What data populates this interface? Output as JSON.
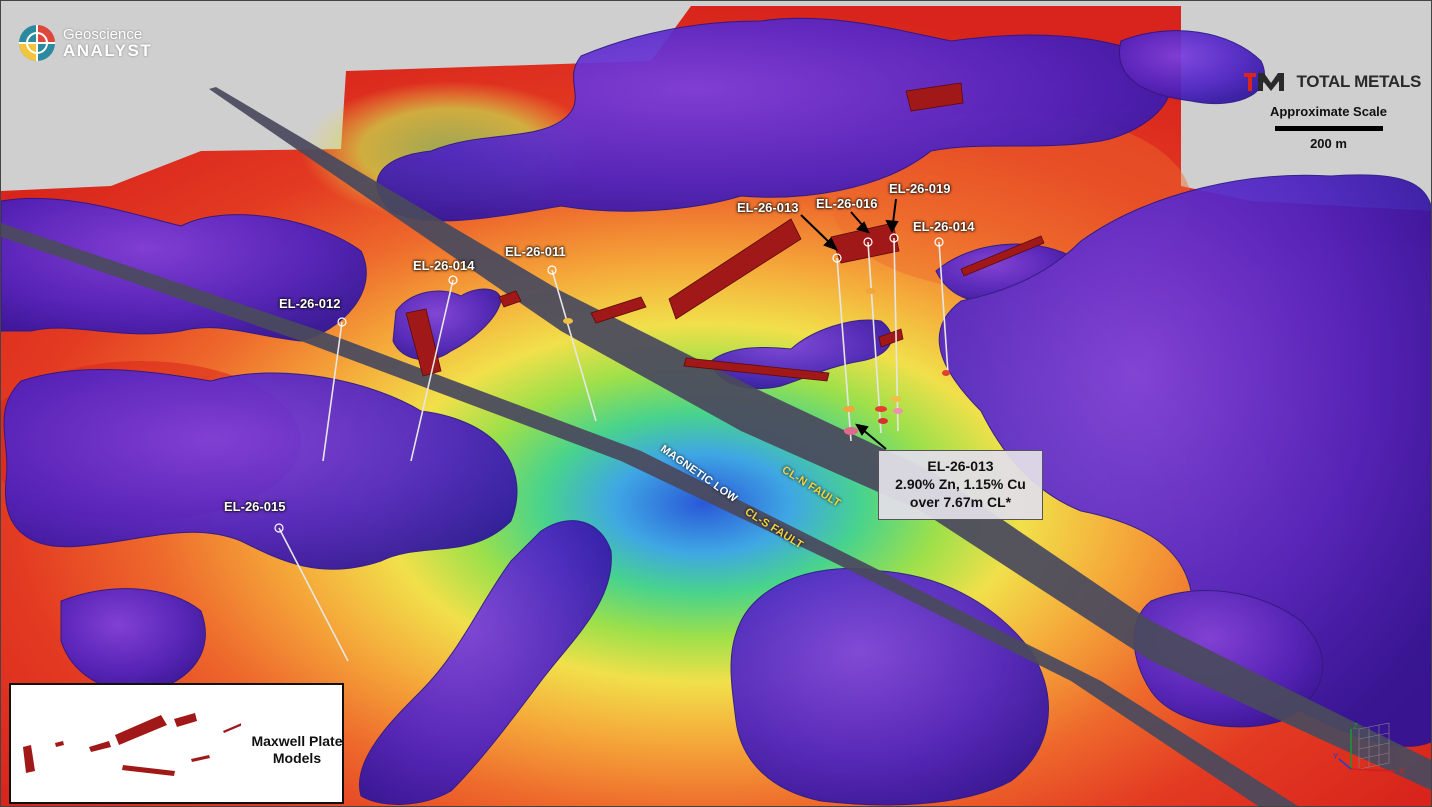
{
  "logo": {
    "line1": "Geoscience",
    "line2": "ANALYST"
  },
  "brand": {
    "name": "TOTAL METALS"
  },
  "scale": {
    "title": "Approximate Scale",
    "label": "200 m"
  },
  "drill_holes": [
    {
      "name": "EL-26-012"
    },
    {
      "name": "EL-26-014"
    },
    {
      "name": "EL-26-011"
    },
    {
      "name": "EL-26-013"
    },
    {
      "name": "EL-26-016"
    },
    {
      "name": "EL-26-019"
    },
    {
      "name": "EL-26-014"
    },
    {
      "name": "EL-26-015"
    }
  ],
  "annotations": {
    "magnetic_low": "MAGNETIC LOW",
    "cl_n_fault": "CL-N FAULT",
    "cl_s_fault": "CL-S FAULT"
  },
  "callout": {
    "line1": "EL-26-013",
    "line2": "2.90% Zn, 1.15% Cu",
    "line3": "over 7.67m CL*"
  },
  "legend": {
    "line1": "Maxwell Plate",
    "line2": "Models"
  },
  "axes": {
    "x": "X",
    "y": "Y",
    "z": "Z"
  },
  "colors": {
    "magnetic_high": "#e53a22",
    "magnetic_mid": "#f2c53c",
    "magnetic_low": "#2f6fd6",
    "isosurface": "#4a1fb8",
    "fault_plane": "#4a4a5e",
    "plate_model": "#a01818",
    "fault_label": "#f6d33c"
  }
}
